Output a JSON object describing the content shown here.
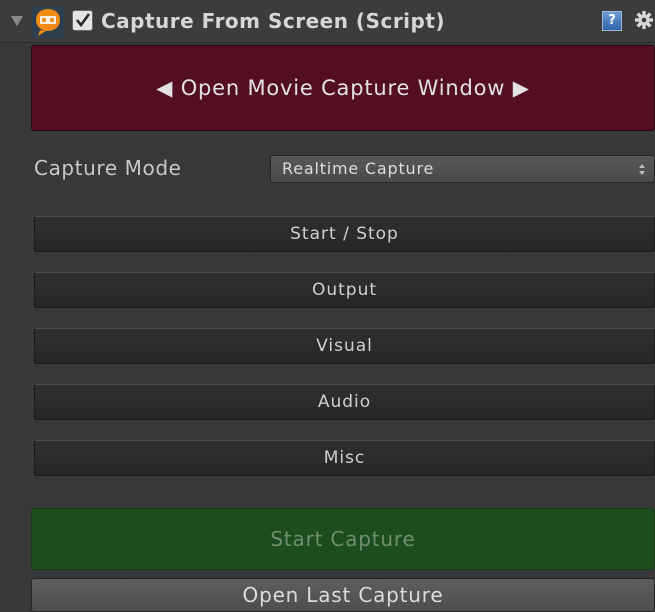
{
  "header": {
    "title": "Capture From Screen (Script)",
    "enabled": true,
    "help_label": "?",
    "icons": {
      "foldout": "triangle-down-icon",
      "logo": "avpro-movie-capture-logo",
      "help": "question-help-icon",
      "settings": "gear-icon"
    }
  },
  "banner": {
    "label": "◀ Open Movie Capture Window ▶",
    "color": "#530e22"
  },
  "capture_mode": {
    "label": "Capture Mode",
    "selected": "Realtime Capture"
  },
  "sections": [
    {
      "label": "Start / Stop"
    },
    {
      "label": "Output"
    },
    {
      "label": "Visual"
    },
    {
      "label": "Audio"
    },
    {
      "label": "Misc"
    }
  ],
  "actions": {
    "start_capture": "Start Capture",
    "open_last_capture": "Open Last Capture",
    "start_color": "#1d4d1f"
  }
}
